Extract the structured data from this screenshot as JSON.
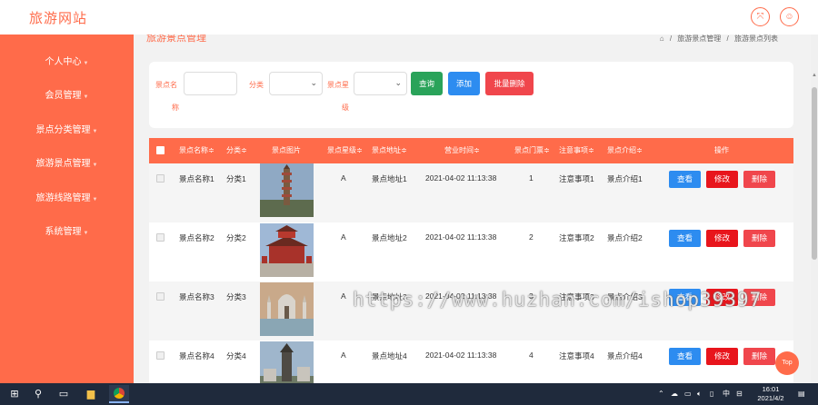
{
  "header": {
    "brand": "旅游网站",
    "fullscreen_icon": "fullscreen-icon",
    "user_icon": "user-icon"
  },
  "sidebar": {
    "items": [
      {
        "label": "个人中心"
      },
      {
        "label": "会员管理"
      },
      {
        "label": "景点分类管理"
      },
      {
        "label": "旅游景点管理"
      },
      {
        "label": "旅游线路管理"
      },
      {
        "label": "系统管理"
      }
    ]
  },
  "page": {
    "title": "旅游景点管理",
    "breadcrumb": [
      "⌂",
      "/",
      "旅游景点管理",
      "/",
      "旅游景点列表"
    ]
  },
  "search": {
    "name_label_a": "景点名",
    "name_label_b": "称",
    "name_value": "",
    "category_label": "分类",
    "category_value": "",
    "star_label_a": "景点星",
    "star_label_b": "级",
    "star_value": "",
    "query_button": "查询",
    "add_button": "添加",
    "batch_delete_button": "批量删除"
  },
  "table": {
    "headers": [
      "景点名称≑",
      "分类≑",
      "景点图片",
      "景点星级≑",
      "景点地址≑",
      "营业时间≑",
      "景点门票≑",
      "注意事项≑",
      "景点介绍≑",
      "操作"
    ],
    "rows": [
      {
        "name": "景点名称1",
        "category": "分类1",
        "star": "A",
        "address": "景点地址1",
        "time": "2021-04-02 11:13:38",
        "ticket": "1",
        "notice": "注意事项1",
        "intro": "景点介绍1"
      },
      {
        "name": "景点名称2",
        "category": "分类2",
        "star": "A",
        "address": "景点地址2",
        "time": "2021-04-02 11:13:38",
        "ticket": "2",
        "notice": "注意事项2",
        "intro": "景点介绍2"
      },
      {
        "name": "景点名称3",
        "category": "分类3",
        "star": "A",
        "address": "景点地址3",
        "time": "2021-04-02 11:13:38",
        "ticket": "3",
        "notice": "注意事项3",
        "intro": "景点介绍3"
      },
      {
        "name": "景点名称4",
        "category": "分类4",
        "star": "A",
        "address": "景点地址4",
        "time": "2021-04-02 11:13:38",
        "ticket": "4",
        "notice": "注意事项4",
        "intro": "景点介绍4"
      }
    ],
    "actions": {
      "view": "查看",
      "edit": "修改",
      "delete": "删除"
    }
  },
  "top_button": "Top",
  "watermark": "https://www.huzhan.com/ishop39397",
  "taskbar": {
    "ime": "中",
    "time": "16:01",
    "date": "2021/4/2"
  },
  "colors": {
    "accent": "#ff6b4a",
    "query": "#2aa35a",
    "add": "#2d8cf0",
    "batch_delete": "#f0464c",
    "view": "#2d8cf0",
    "edit": "#e8151c",
    "delete": "#f0464c"
  }
}
